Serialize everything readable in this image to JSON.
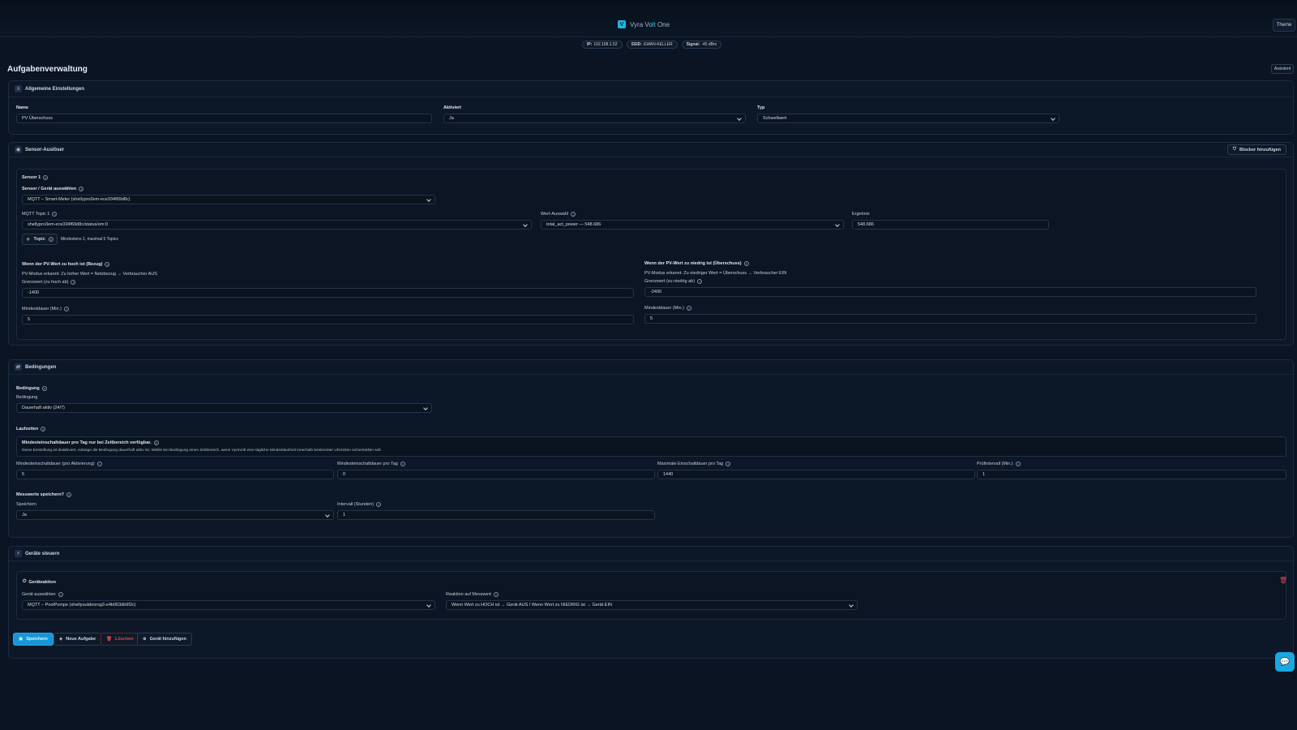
{
  "app": {
    "brand_a": "Vyra Vo",
    "brand_b": "lt",
    "brand_c": " One",
    "logo_letter": "V",
    "theme_button": "Theme"
  },
  "status": {
    "ip_label": "IP:",
    "ip_value": "192.168.1.52",
    "ssid_label": "SSID:",
    "ssid_value": "EWAN-KELLER",
    "signal_label": "Signal:",
    "signal_value": "-45 dBm"
  },
  "page": {
    "title": "Aufgabenverwaltung",
    "assistant_button": "Assistent"
  },
  "general": {
    "header": "Allgemeine Einstellungen",
    "name_label": "Name",
    "name_value": "PV Überschuss",
    "active_label": "Aktiviert",
    "active_value": "Ja",
    "type_label": "Typ",
    "type_value": "Schwellwert"
  },
  "sensor": {
    "header": "Sensor-Auslöser",
    "add_blocker": "Blocker hinzufügen",
    "sensor_title": "Sensor 1",
    "device_label": "Sensor / Gerät auswählen",
    "device_value": "MQTT – Smart-Meter (shellypro3em-ece334f69d8c)",
    "topic_label": "MQTT Topic 1",
    "topic_value": "shellypro3em-ece334f69d8c/status/em:0",
    "value_label": "Wert-Auswahl",
    "value_value": "total_act_power — 548.686",
    "result_label": "Ergebnis",
    "result_value": "548.686",
    "add_topic": "Topic",
    "topic_hint": "Mindestens 1, maximal 5 Topics",
    "high_title": "Wenn der PV-Wert zu hoch ist (Bezug)",
    "high_desc": "PV-Modus erkannt: Zu hoher Wert = Netzbezug → Verbraucher AUS",
    "high_threshold_label": "Grenzwert (zu hoch ab)",
    "high_threshold_value": "-1400",
    "high_duration_label": "Mindestdauer (Min.)",
    "high_duration_value": "5",
    "low_title": "Wenn der PV-Wert zu niedrig ist (Überschuss)",
    "low_desc": "PV-Modus erkannt: Zu niedriger Wert = Überschuss → Verbraucher EIN",
    "low_threshold_label": "Grenzwert (zu niedrig ab)",
    "low_threshold_value": "-2400",
    "low_duration_label": "Mindestdauer (Min.)",
    "low_duration_value": "5"
  },
  "conditions": {
    "header": "Bedingungen",
    "condition_title": "Bedingung",
    "condition_label": "Bedingung",
    "condition_value": "Dauerhaft aktiv (24/7)",
    "runtimes_title": "Laufzeiten",
    "info_title": "Mindesteinschaltdauer pro Tag nur bei Zeitbereich verfügbar.",
    "info_text": "Diese Einstellung ist deaktiviert, solange die Bedingung dauerhaft aktiv ist. Wähle bei Bedingung einen Zeitbereich, wenn VyraVolt eine tägliche Mindestlaufzeit innerhalb bestimmter Uhrzeiten sicherstellen soll.",
    "min_on_label": "Mindesteinschaltdauer (pro Aktivierung)",
    "min_on_value": "5",
    "min_day_label": "Mindesteinschaltdauer pro Tag",
    "min_day_value": "0",
    "max_day_label": "Maximale Einschaltdauer pro Tag",
    "max_day_value": "1440",
    "check_label": "Prüfintervall (Min.)",
    "check_value": "1",
    "store_title": "Messwerte speichern?",
    "store_label": "Speichern",
    "store_value": "Ja",
    "interval_label": "Intervall (Stunden)",
    "interval_value": "1"
  },
  "devices": {
    "header": "Geräte steuern",
    "action_title": "Geräteaktion",
    "device_label": "Gerät auswählen",
    "device_value": "MQTT – PoolPumpe (shellyoutdoorsg3-e4b063db9f2c)",
    "reaction_label": "Reaktion auf Messwert",
    "reaction_value": "Wenn Wert zu HOCH ist → Gerät AUS / Wenn Wert zu NIEDRIG ist → Gerät EIN"
  },
  "actions": {
    "save": "Speichern",
    "new_task": "Neue Aufgabe",
    "delete": "Löschen",
    "add_device": "Gerät hinzufügen"
  },
  "icons": {
    "chat": "chat-icon",
    "trash": "trash-icon"
  },
  "colors": {
    "accent": "#1fb6e8",
    "danger": "#e0474b",
    "background": "#0b1422"
  }
}
